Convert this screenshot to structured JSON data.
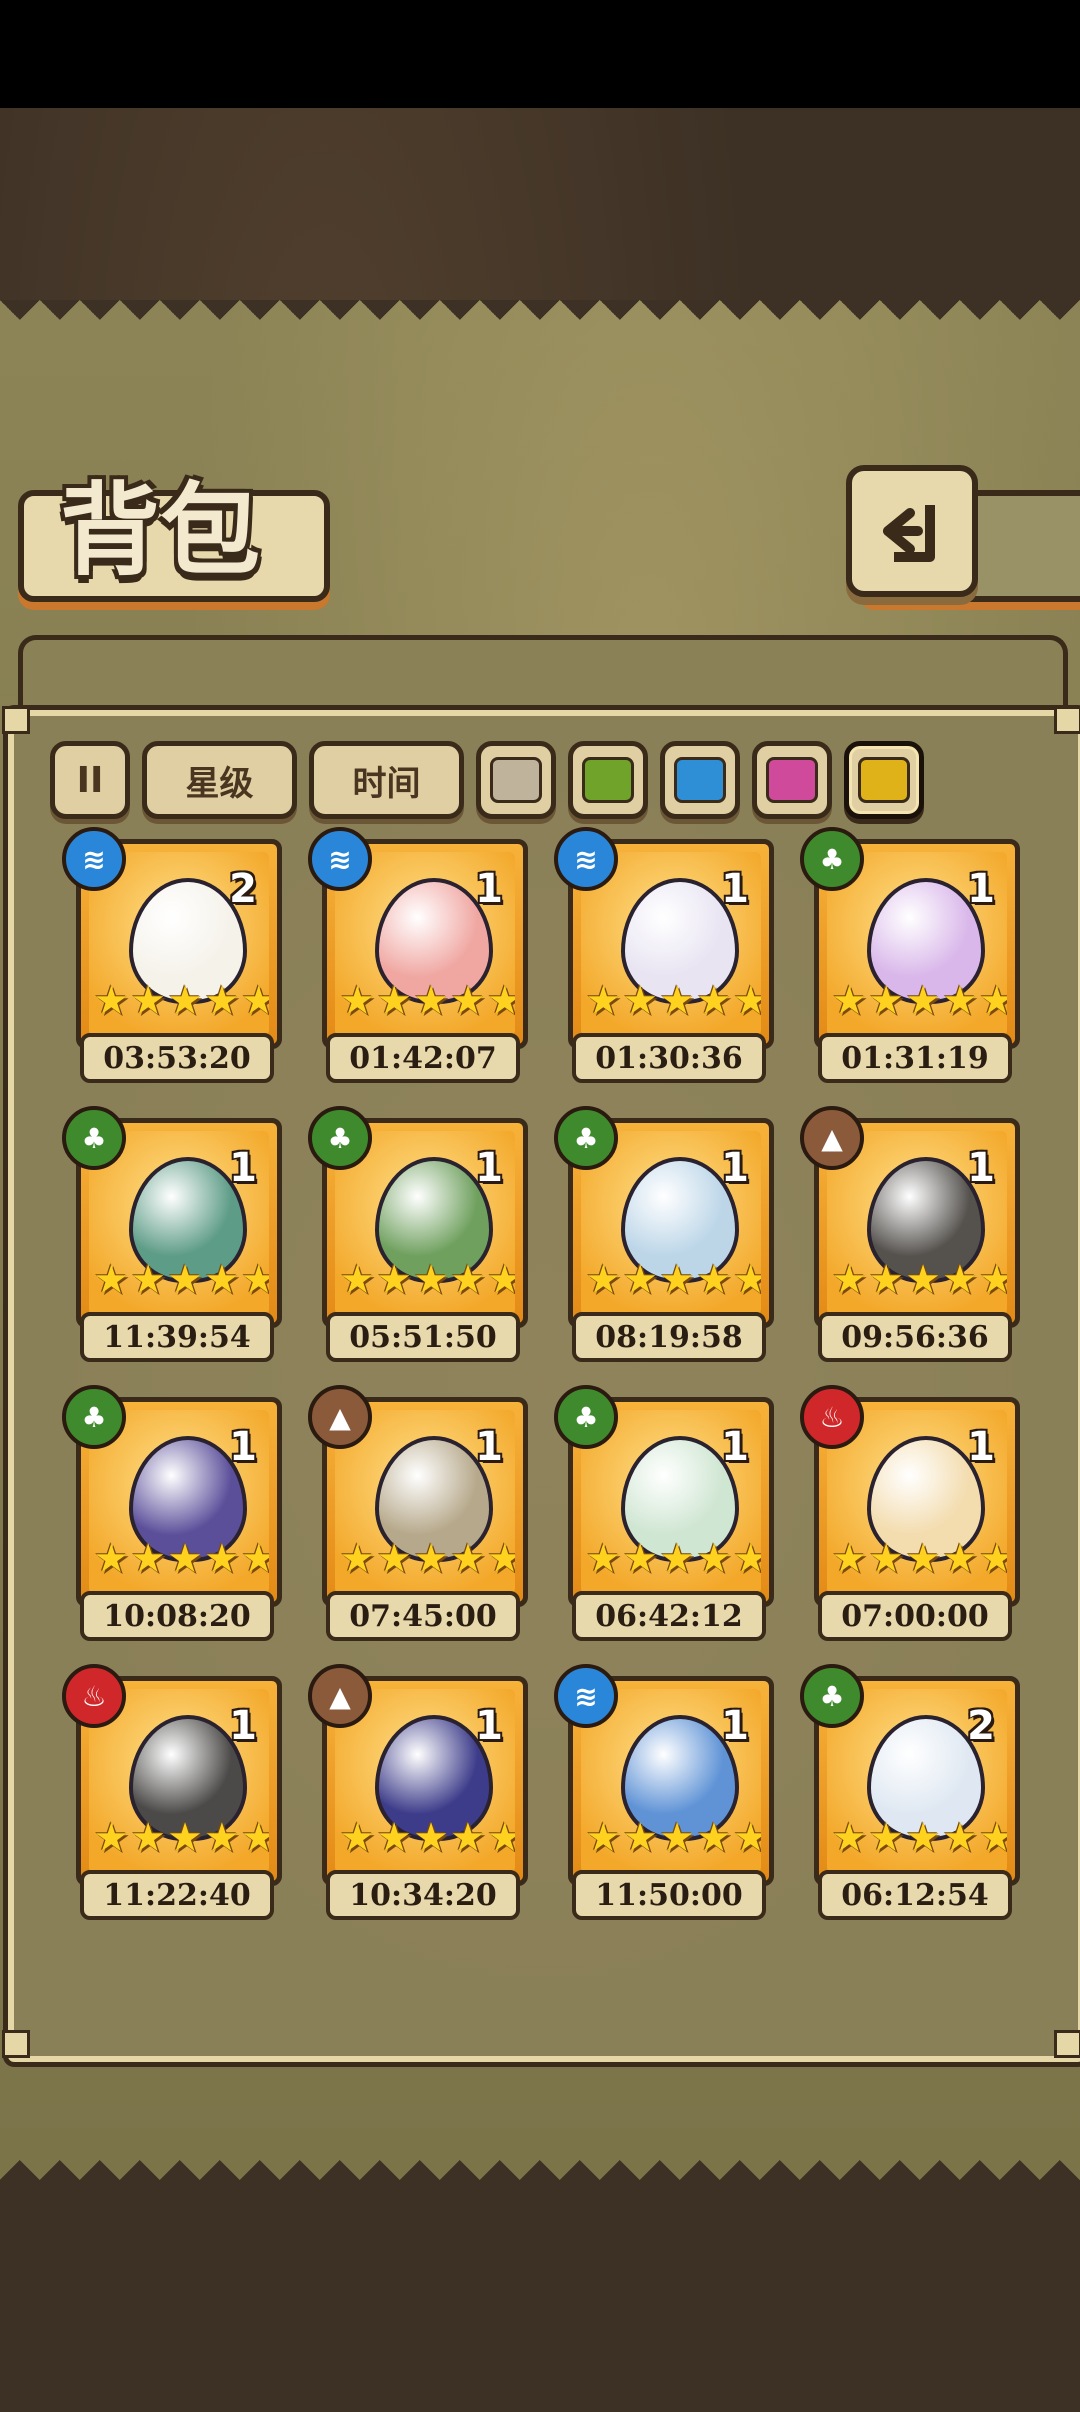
{
  "title": "背包",
  "filters": {
    "pause_symbol": "II",
    "star_label": "星级",
    "time_label": "时间",
    "swatches": [
      {
        "name": "gray",
        "color": "#bfb39c"
      },
      {
        "name": "green",
        "color": "#6fa32a"
      },
      {
        "name": "blue",
        "color": "#2f8fd6"
      },
      {
        "name": "pink",
        "color": "#d04a9c"
      },
      {
        "name": "yellow",
        "color": "#e0b21a",
        "selected": true
      }
    ]
  },
  "elements": {
    "water": {
      "icon": "≋",
      "color": "#2a86d8"
    },
    "leaf": {
      "icon": "♣",
      "color": "#3f8a2c"
    },
    "earth": {
      "icon": "▲",
      "color": "#8a5a3a"
    },
    "fire": {
      "icon": "♨",
      "color": "#d0282a"
    }
  },
  "items": [
    {
      "element": "water",
      "count": "2",
      "stars": 5,
      "timer": "03:53:20",
      "egg": "#f5f2ea"
    },
    {
      "element": "water",
      "count": "1",
      "stars": 5,
      "timer": "01:42:07",
      "egg": "#f0a7a2"
    },
    {
      "element": "water",
      "count": "1",
      "stars": 5,
      "timer": "01:30:36",
      "egg": "#e8e4f2"
    },
    {
      "element": "leaf",
      "count": "1",
      "stars": 5,
      "timer": "01:31:19",
      "egg": "#d9b7ea"
    },
    {
      "element": "leaf",
      "count": "1",
      "stars": 5,
      "timer": "11:39:54",
      "egg": "#5d9c86"
    },
    {
      "element": "leaf",
      "count": "1",
      "stars": 5,
      "timer": "05:51:50",
      "egg": "#6fa05e"
    },
    {
      "element": "leaf",
      "count": "1",
      "stars": 5,
      "timer": "08:19:58",
      "egg": "#bcd6e8"
    },
    {
      "element": "earth",
      "count": "1",
      "stars": 5,
      "timer": "09:56:36",
      "egg": "#55524e"
    },
    {
      "element": "leaf",
      "count": "1",
      "stars": 5,
      "timer": "10:08:20",
      "egg": "#5b4f9a"
    },
    {
      "element": "earth",
      "count": "1",
      "stars": 5,
      "timer": "07:45:00",
      "egg": "#b6a88a"
    },
    {
      "element": "leaf",
      "count": "1",
      "stars": 5,
      "timer": "06:42:12",
      "egg": "#cfe6d2"
    },
    {
      "element": "fire",
      "count": "1",
      "stars": 5,
      "timer": "07:00:00",
      "egg": "#f3dcae"
    },
    {
      "element": "fire",
      "count": "1",
      "stars": 5,
      "timer": "11:22:40",
      "egg": "#4b4a48"
    },
    {
      "element": "earth",
      "count": "1",
      "stars": 5,
      "timer": "10:34:20",
      "egg": "#3d3c8a"
    },
    {
      "element": "water",
      "count": "1",
      "stars": 5,
      "timer": "11:50:00",
      "egg": "#5f93d6"
    },
    {
      "element": "leaf",
      "count": "2",
      "stars": 5,
      "timer": "06:12:54",
      "egg": "#dfe8f2"
    }
  ]
}
